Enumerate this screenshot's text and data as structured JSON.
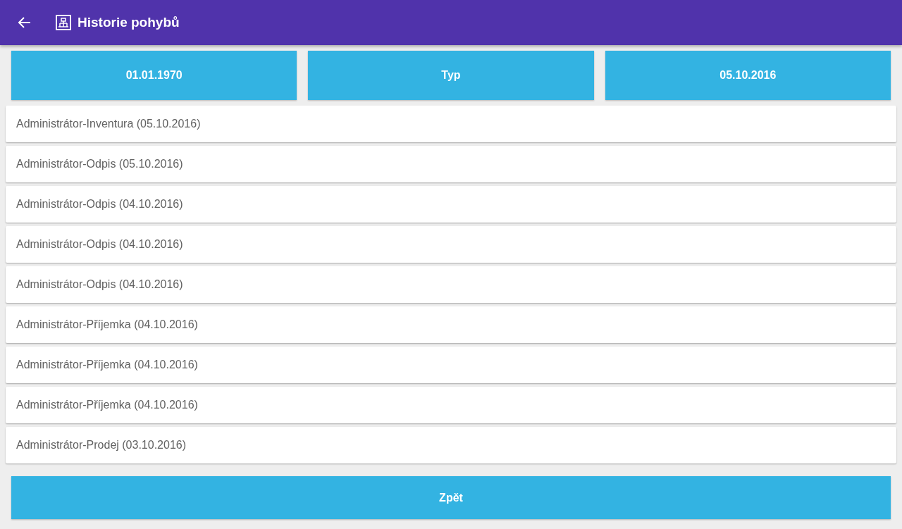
{
  "app_bar": {
    "title": "Historie pohybů"
  },
  "filters": [
    {
      "label": "01.01.1970"
    },
    {
      "label": "Typ"
    },
    {
      "label": "05.10.2016"
    }
  ],
  "movements": [
    "Administrátor-Inventura (05.10.2016)",
    "Administrátor-Odpis (05.10.2016)",
    "Administrátor-Odpis (04.10.2016)",
    "Administrátor-Odpis (04.10.2016)",
    "Administrátor-Odpis (04.10.2016)",
    "Administrátor-Příjemka (04.10.2016)",
    "Administrátor-Příjemka (04.10.2016)",
    "Administrátor-Příjemka (04.10.2016)",
    "Administrátor-Prodej (03.10.2016)"
  ],
  "back_button": {
    "label": "Zpět"
  }
}
